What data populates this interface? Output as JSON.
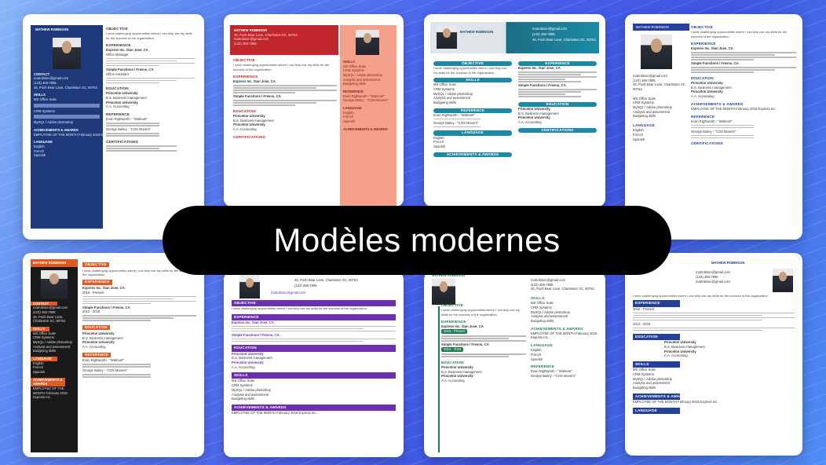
{
  "banner": {
    "title": "Modèles modernes"
  },
  "resume": {
    "name": "MATHEW ROBINSON",
    "objective_h": "OBJECTIVE",
    "objective": "I seek challenging opportunities where I can fully use my skills for the success of the organization.",
    "experience_h": "EXPERIENCE",
    "job1": "Express Inc. /San Jose, CA",
    "job1_role": "Office Manager",
    "job1_dates": "2016 - Present",
    "job2": "Simple Functions / Fresno, CA",
    "job2_role": "Office Assistant",
    "job2_dates": "2012 - 2016",
    "education_h": "EDUCATION",
    "edu1": "Princeton University",
    "edu1_deg": "B.S. Business management",
    "edu2": "Princeton University",
    "edu2_deg": "A.A. Accounting",
    "contact_h": "CONTACT",
    "email": "matrobison@gmail.com",
    "phone": "(123) 456-7895",
    "address": "45, Pooh Bear Lane, Charleston SC, 90764",
    "skills_h": "SKILLS",
    "skills": [
      "MS Office Suite",
      "CRM Systems",
      "MySQL / Adobe photoshop",
      "Analysis and assessment",
      "Budgeting skills"
    ],
    "reference_h": "REFERENCE",
    "ref1": "Evan Rightworth - \"Walmart\"",
    "ref2": "George Bailey - \"COS Movers\"",
    "language_h": "LANGUAGE",
    "languages": [
      "English",
      "French",
      "Spanish"
    ],
    "awards_h": "ACHIEVEMENTS & AWARDS",
    "award": "EMPLOYEE OF THE MONTH February 2018 Express Inc.",
    "cert_h": "CERTIFICATIONS"
  },
  "colors": {
    "navy": "#1f3a7a",
    "red": "#c0262c",
    "salmon": "#f5a08a",
    "teal": "#1d8aa5",
    "blue": "#23409a",
    "orange": "#e05a23",
    "purple": "#6d2fb0",
    "green": "#1c7d52"
  }
}
